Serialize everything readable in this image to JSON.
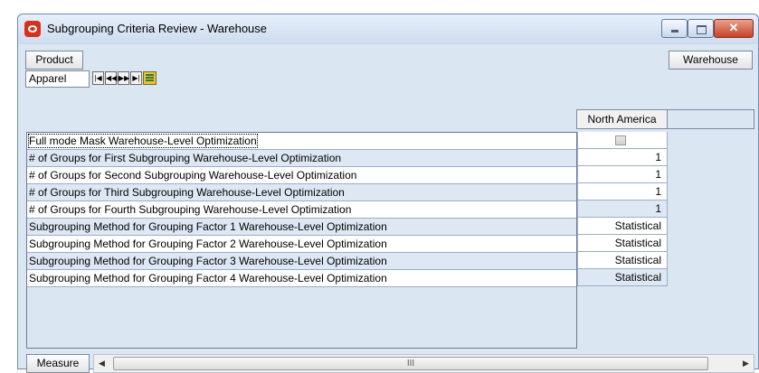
{
  "window": {
    "title": "Subgrouping Criteria Review - Warehouse",
    "close_symbol": "✕"
  },
  "toolbar": {
    "product_label": "Product",
    "warehouse_label": "Warehouse",
    "product_value": "Apparel",
    "nav_icons": [
      "first-icon",
      "previous-icon",
      "next-icon",
      "last-icon",
      "grid-view-icon"
    ],
    "nav_glyphs": [
      "|◀",
      "◀◀",
      "▶▶",
      "▶|"
    ]
  },
  "grid": {
    "column_header": "North America",
    "rows": [
      {
        "label": "Full mode Mask Warehouse-Level Optimization",
        "value": "",
        "type": "checkbox",
        "checked": false
      },
      {
        "label": "# of Groups for First Subgrouping Warehouse-Level Optimization",
        "value": "1"
      },
      {
        "label": "# of Groups for Second Subgrouping Warehouse-Level Optimization",
        "value": "1"
      },
      {
        "label": "# of Groups for Third Subgrouping Warehouse-Level Optimization",
        "value": "1"
      },
      {
        "label": "# of Groups for Fourth Subgrouping Warehouse-Level Optimization",
        "value": "1"
      },
      {
        "label": "Subgrouping Method for Grouping Factor 1 Warehouse-Level Optimization",
        "value": "Statistical"
      },
      {
        "label": "Subgrouping Method for Grouping Factor 2 Warehouse-Level Optimization",
        "value": "Statistical"
      },
      {
        "label": "Subgrouping Method for Grouping Factor 3 Warehouse-Level Optimization",
        "value": "Statistical"
      },
      {
        "label": "Subgrouping Method for Grouping Factor 4 Warehouse-Level Optimization",
        "value": "Statistical"
      }
    ]
  },
  "bottom": {
    "measure_label": "Measure",
    "scroll_thumb_grip": "III"
  },
  "colors": {
    "background": "#dbe6f3",
    "alt_row": "#dde8f4",
    "close_button": "#c8432a",
    "app_icon": "#d9301e"
  }
}
